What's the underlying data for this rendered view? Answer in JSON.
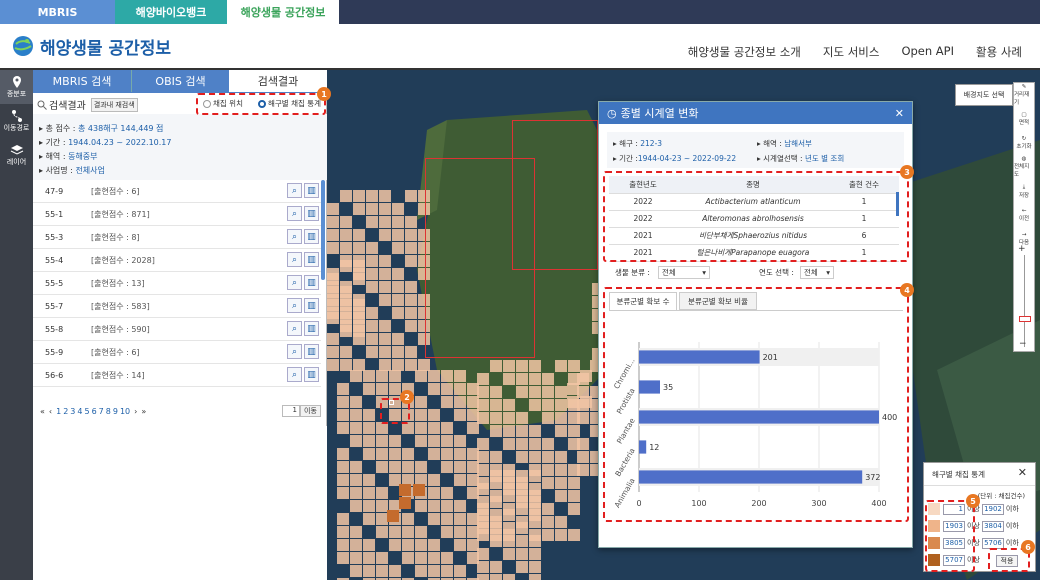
{
  "top_tabs": [
    "MBRIS",
    "해양바이오뱅크",
    "해양생물 공간정보"
  ],
  "logo_title": "해양생물 공간정보",
  "gnb": [
    "해양생물 공간정보 소개",
    "지도 서비스",
    "Open API",
    "활용 사례"
  ],
  "rail": [
    "종분포",
    "이동경로",
    "레이어"
  ],
  "panel": {
    "tabs": [
      "MBRIS 검색",
      "OBIS 검색",
      "검색결과"
    ],
    "search_label": "검색결과",
    "refine_btn": "결과내 재검색",
    "radio1": "채집 위치",
    "radio2": "해구별 채집 통계",
    "info": [
      {
        "k": "총 점수 :",
        "v": "총 438해구 144,449 점"
      },
      {
        "k": "기간 :",
        "v": "1944.04.23 ~ 2022.10.17"
      },
      {
        "k": "해역 :",
        "v": "동해중부"
      },
      {
        "k": "사업명 :",
        "v": "전체사업"
      }
    ],
    "rows": [
      {
        "code": "47-9",
        "cnt": "[출현점수 : 6]"
      },
      {
        "code": "55-1",
        "cnt": "[출현점수 : 871]"
      },
      {
        "code": "55-3",
        "cnt": "[출현점수 : 8]"
      },
      {
        "code": "55-4",
        "cnt": "[출현점수 : 2028]"
      },
      {
        "code": "55-5",
        "cnt": "[출현점수 : 13]"
      },
      {
        "code": "55-7",
        "cnt": "[출현점수 : 583]"
      },
      {
        "code": "55-8",
        "cnt": "[출현점수 : 590]"
      },
      {
        "code": "55-9",
        "cnt": "[출현점수 : 6]"
      },
      {
        "code": "56-6",
        "cnt": "[출현점수 : 14]"
      }
    ],
    "pager": {
      "pages": [
        "1",
        "2",
        "3",
        "4",
        "5",
        "6",
        "7",
        "8",
        "9",
        "10"
      ],
      "first": "«",
      "prev": "‹",
      "next": "›",
      "last": "»",
      "page_input": "1",
      "go": "이동"
    }
  },
  "dialog": {
    "title": "종별 시계열 변화",
    "close": "✕",
    "info": [
      {
        "k": "해구 :",
        "v": "212-3"
      },
      {
        "k": "해역 :",
        "v": "남해서부"
      },
      {
        "k": "기간 :",
        "v": "1944-04-23 ~ 2022-09-22"
      },
      {
        "k": "시계열선택 :",
        "v": "년도 별 조회"
      }
    ],
    "table": {
      "headers": [
        "출현년도",
        "종명",
        "출현 건수"
      ],
      "rows": [
        {
          "year": "2022",
          "name": "Actibacterium atlanticum",
          "cnt": "1"
        },
        {
          "year": "2022",
          "name": "Alteromonas abrolhosensis",
          "cnt": "1"
        },
        {
          "year": "2021",
          "name": "비단부채게Sphaerozius nitidus",
          "cnt": "6"
        },
        {
          "year": "2021",
          "name": "털은나비게Parapanope euagora",
          "cnt": "1"
        }
      ]
    },
    "filter1_label": "생물 분류 :",
    "filter1_value": "전체",
    "filter2_label": "연도 선택 :",
    "filter2_value": "전체",
    "chart_tabs": [
      "분류군별 확보 수",
      "분류군별 확보 비율"
    ]
  },
  "chart_data": {
    "type": "bar",
    "orientation": "horizontal",
    "categories": [
      "Chromi...",
      "Protista",
      "Plantae",
      "Bacteria",
      "Animalia"
    ],
    "values": [
      201,
      35,
      400,
      12,
      372
    ],
    "xlim": [
      0,
      400
    ],
    "xticks": [
      0,
      100,
      200,
      300,
      400
    ],
    "bar_color": "#4f6fc9"
  },
  "legend": {
    "title": "해구별 채집 통계",
    "close": "✕",
    "unit": "(단위 : 채집건수)",
    "rows": [
      {
        "min": "1",
        "max": "1902",
        "color": "#f7d9c2"
      },
      {
        "min": "1903",
        "max": "3804",
        "color": "#efb48a"
      },
      {
        "min": "3805",
        "max": "5706",
        "color": "#d9894e"
      },
      {
        "min": "5707",
        "max": "",
        "color": "#b0611f"
      }
    ],
    "above": "이상",
    "below": "이하",
    "apply": "적용"
  },
  "map": {
    "basemap_btn": "배경지도 선택",
    "tools": [
      "거리재기",
      "면적",
      "초기화",
      "전체지도",
      "저장",
      "이전",
      "다음"
    ]
  },
  "badges": [
    "1",
    "2",
    "3",
    "4",
    "5",
    "6"
  ]
}
